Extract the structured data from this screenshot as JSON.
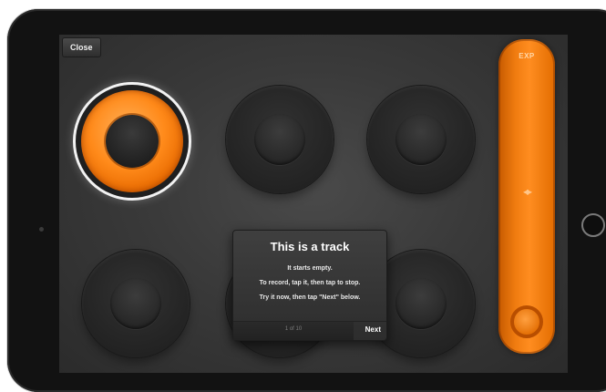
{
  "toolbar": {
    "close_label": "Close"
  },
  "tracks": [
    {
      "state": "active"
    },
    {
      "state": "empty"
    },
    {
      "state": "empty"
    },
    {
      "state": "empty"
    },
    {
      "state": "empty"
    },
    {
      "state": "empty"
    }
  ],
  "slider": {
    "label": "EXP",
    "arrows": "◂▸"
  },
  "tutorial": {
    "title": "This is a track",
    "line1": "It starts empty.",
    "line2": "To record, tap it, then tap to stop.",
    "line3": "Try it now, then tap \"Next\" below.",
    "progress": "1 of 10",
    "next_label": "Next"
  },
  "colors": {
    "accent": "#ff8a1a",
    "background": "#3a3a3a",
    "dialog": "#353535"
  },
  "icons": {
    "device": "tablet",
    "home": "home-button"
  }
}
